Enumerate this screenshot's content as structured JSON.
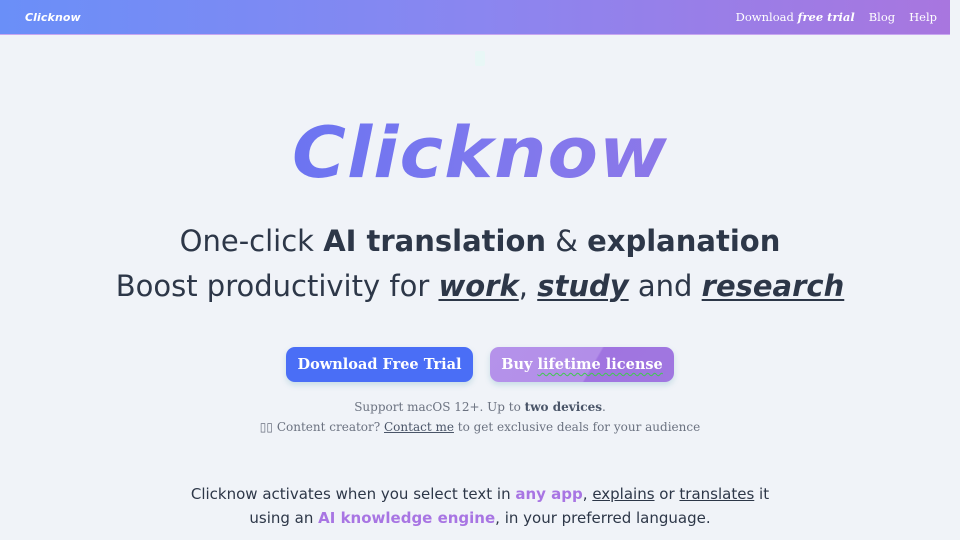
{
  "header": {
    "brand": "Clicknow",
    "nav": {
      "download_prefix": "Download ",
      "download_em": "free trial",
      "blog": "Blog",
      "help": "Help"
    }
  },
  "hero": {
    "logo": "Clicknow",
    "line1": {
      "a": "One-click ",
      "b": "AI translation",
      "c": " & ",
      "d": "explanation"
    },
    "line2": {
      "a": "Boost productivity for ",
      "work": "work",
      "comma": ", ",
      "study": "study",
      "and": " and ",
      "research": "research"
    }
  },
  "buttons": {
    "primary": "Download Free Trial",
    "secondary_a": "Buy ",
    "secondary_b": "lifetime license"
  },
  "support": {
    "line1_a": "Support macOS 12+. Up to ",
    "line1_b": "two devices",
    "line1_c": ".",
    "line2_icon": "▯▯",
    "line2_a": " Content creator? ",
    "line2_link": "Contact me",
    "line2_b": " to get exclusive deals for your audience"
  },
  "description": {
    "l1_a": "Clicknow activates when you select text in ",
    "l1_hl": "any app",
    "l1_b": ", ",
    "l1_explains": "explains",
    "l1_c": " or ",
    "l1_translates": "translates",
    "l1_d": " it",
    "l2_a": "using an ",
    "l2_hl": "AI knowledge engine",
    "l2_b": ", in your preferred language."
  },
  "colors": {
    "accent_blue": "#4a6ef6",
    "accent_purple": "#a875e3",
    "text_dark": "#2d3748"
  }
}
